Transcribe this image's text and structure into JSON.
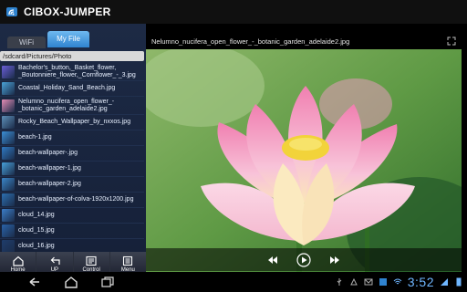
{
  "app": {
    "title": "CIBOX-JUMPER"
  },
  "tabs": {
    "wifi": "WiFi",
    "my_file": "My File"
  },
  "path": "/sdcard/Pictures/Photo",
  "files": [
    {
      "name": "Bachelor's_button,_Basket_flower,\n_Boutonniere_flower,_Cornflower_-_3.jpg",
      "thumb": "#6a5ed6"
    },
    {
      "name": "Coastal_Holiday_Sand_Beach.jpg",
      "thumb": "#4aa3d8"
    },
    {
      "name": "Nelumno_nucifera_open_flower_-\n_botanic_garden_adelaide2.jpg",
      "thumb": "#e58db5"
    },
    {
      "name": "Rocky_Beach_Wallpaper_by_nxxos.jpg",
      "thumb": "#5d8fb8"
    },
    {
      "name": "beach-1.jpg",
      "thumb": "#3b8fd6"
    },
    {
      "name": "beach-wallpaper-.jpg",
      "thumb": "#2f79c2"
    },
    {
      "name": "beach-wallpaper-1.jpg",
      "thumb": "#47a0d9"
    },
    {
      "name": "beach-wallpaper-2.jpg",
      "thumb": "#3a86c8"
    },
    {
      "name": "beach-wallpaper-of-colva-1920x1200.jpg",
      "thumb": "#2c6fb0"
    },
    {
      "name": "cloud_14.jpg",
      "thumb": "#3b7ec9"
    },
    {
      "name": "cloud_15.jpg",
      "thumb": "#2a63a8"
    },
    {
      "name": "cloud_16.jpg",
      "thumb": "#1f3d6b"
    }
  ],
  "toolbar": {
    "home": "Home",
    "up": "UP",
    "control": "Control",
    "menu": "Menu"
  },
  "viewer": {
    "title": "Nelumno_nucifera_open_flower_-_botanic_garden_adelaide2.jpg"
  },
  "status": {
    "time": "3:52"
  },
  "colors": {
    "accent": "#2f83cf",
    "clock": "#6fb6ff",
    "panel": "#1d2a45"
  }
}
